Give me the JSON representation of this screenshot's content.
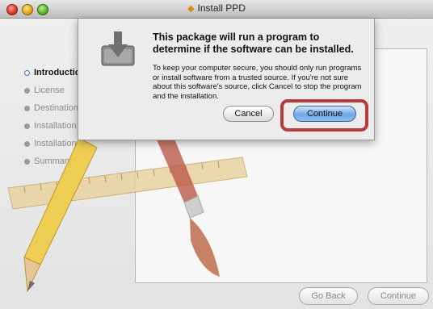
{
  "window": {
    "title": "Install PPD",
    "title_icon": "package-icon"
  },
  "sidebar": {
    "items": [
      {
        "label": "Introduction",
        "active": true
      },
      {
        "label": "License",
        "active": false
      },
      {
        "label": "Destination Select",
        "active": false
      },
      {
        "label": "Installation Type",
        "active": false
      },
      {
        "label": "Installation",
        "active": false
      },
      {
        "label": "Summary",
        "active": false
      }
    ]
  },
  "footer": {
    "go_back_label": "Go Back",
    "continue_label": "Continue"
  },
  "sheet": {
    "heading": "This package will run a program to determine if the software can be installed.",
    "body": "To keep your computer secure, you should only run programs or install software from a trusted source. If you're not sure about this software's source, click Cancel to stop the program and the installation.",
    "cancel_label": "Cancel",
    "continue_label": "Continue"
  },
  "colors": {
    "highlight": "#b83a3a",
    "default_button": "#6ea7e6"
  }
}
